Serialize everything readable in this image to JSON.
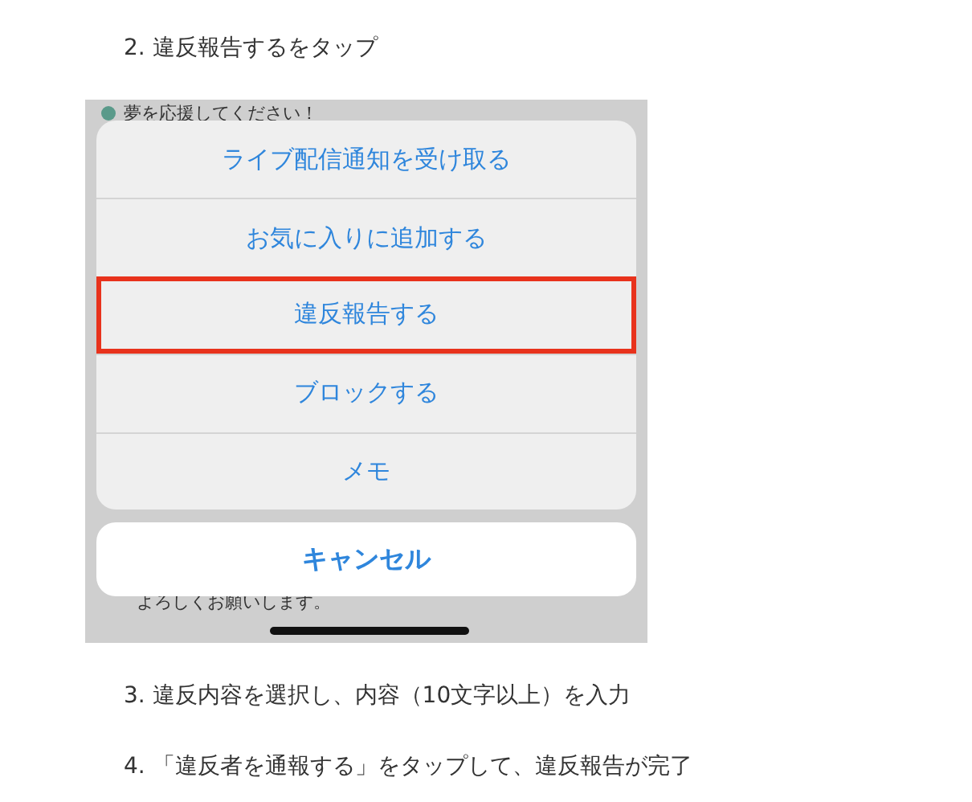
{
  "steps_before": [
    {
      "text": "2. 違反報告するをタップ"
    }
  ],
  "screenshot": {
    "background_lines": [
      {
        "text": "夢を応援してください！",
        "bullet": true
      },
      {
        "text": "よろしくお願いします。",
        "bullet": false
      }
    ],
    "actions": [
      {
        "label": "ライブ配信通知を受け取る",
        "highlighted": false
      },
      {
        "label": "お気に入りに追加する",
        "highlighted": false
      },
      {
        "label": "違反報告する",
        "highlighted": true
      },
      {
        "label": "ブロックする",
        "highlighted": false
      },
      {
        "label": "メモ",
        "highlighted": false
      }
    ],
    "cancel": "キャンセル"
  },
  "steps_after": [
    {
      "text": "3. 違反内容を選択し、内容（10文字以上）を入力"
    },
    {
      "text": "4. 「違反者を通報する」をタップして、違反報告が完了"
    }
  ]
}
